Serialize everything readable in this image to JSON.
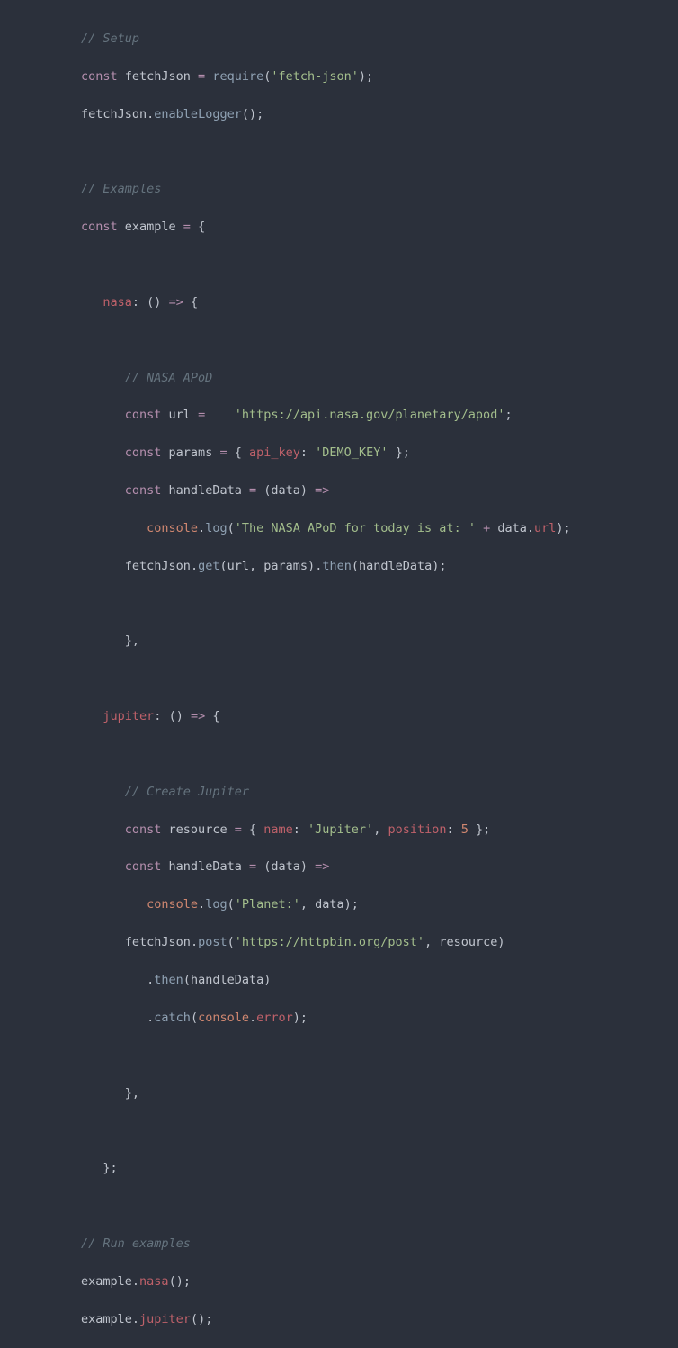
{
  "lines": {
    "l1_comment": "// Setup",
    "l2_const": "const",
    "l2_fetchJson": " fetchJson ",
    "l2_eq": "=",
    "l2_require": " require",
    "l2_p1": "(",
    "l2_str": "'fetch-json'",
    "l2_p2": ")",
    "l2_semi": ";",
    "l3_fetchJson": "fetchJson",
    "l3_dot": ".",
    "l3_enable": "enableLogger",
    "l3_p": "();",
    "l5_comment": "// Examples",
    "l6_const": "const",
    "l6_example": " example ",
    "l6_eq": "=",
    "l6_brace": " {",
    "l8_nasa": "nasa",
    "l8_colon": ":",
    "l8_parens": " () ",
    "l8_arrow": "=>",
    "l8_brace": " {",
    "l10_comment": "// NASA APoD",
    "l11_const": "const",
    "l11_url": " url ",
    "l11_eq": "=",
    "l11_sp": "    ",
    "l11_str": "'https://api.nasa.gov/planetary/apod'",
    "l11_semi": ";",
    "l12_const": "const",
    "l12_params": " params ",
    "l12_eq": "=",
    "l12_brace1": " { ",
    "l12_apikey": "api_key",
    "l12_colon": ":",
    "l12_sp": " ",
    "l12_str": "'DEMO_KEY'",
    "l12_brace2": " };",
    "l13_const": "const",
    "l13_handle": " handleData ",
    "l13_eq": "=",
    "l13_p1": " (",
    "l13_data": "data",
    "l13_p2": ") ",
    "l13_arrow": "=>",
    "l14_console": "console",
    "l14_dot": ".",
    "l14_log": "log",
    "l14_p1": "(",
    "l14_str": "'The NASA APoD for today is at: '",
    "l14_plus": " + ",
    "l14_data": "data",
    "l14_dot2": ".",
    "l14_url": "url",
    "l14_p2": ");",
    "l15_fetchJson": "fetchJson",
    "l15_dot": ".",
    "l15_get": "get",
    "l15_p1": "(",
    "l15_url": "url",
    "l15_comma": ", ",
    "l15_params": "params",
    "l15_p2": ")",
    "l15_dot2": ".",
    "l15_then": "then",
    "l15_p3": "(",
    "l15_handle": "handleData",
    "l15_p4": ");",
    "l17_close": "},",
    "l19_jupiter": "jupiter",
    "l19_colon": ":",
    "l19_parens": " () ",
    "l19_arrow": "=>",
    "l19_brace": " {",
    "l21_comment": "// Create Jupiter",
    "l22_const": "const",
    "l22_resource": " resource ",
    "l22_eq": "=",
    "l22_brace1": " { ",
    "l22_name": "name",
    "l22_colon1": ":",
    "l22_sp1": " ",
    "l22_str": "'Jupiter'",
    "l22_comma": ", ",
    "l22_position": "position",
    "l22_colon2": ":",
    "l22_sp2": " ",
    "l22_num": "5",
    "l22_brace2": " };",
    "l23_const": "const",
    "l23_handle": " handleData ",
    "l23_eq": "=",
    "l23_p1": " (",
    "l23_data": "data",
    "l23_p2": ") ",
    "l23_arrow": "=>",
    "l24_console": "console",
    "l24_dot": ".",
    "l24_log": "log",
    "l24_p1": "(",
    "l24_str": "'Planet:'",
    "l24_comma": ", ",
    "l24_data": "data",
    "l24_p2": ");",
    "l25_fetchJson": "fetchJson",
    "l25_dot": ".",
    "l25_post": "post",
    "l25_p1": "(",
    "l25_str": "'https://httpbin.org/post'",
    "l25_comma": ", ",
    "l25_resource": "resource",
    "l25_p2": ")",
    "l26_dot": ".",
    "l26_then": "then",
    "l26_p1": "(",
    "l26_handle": "handleData",
    "l26_p2": ")",
    "l27_dot": ".",
    "l27_catch": "catch",
    "l27_p1": "(",
    "l27_console": "console",
    "l27_dot2": ".",
    "l27_error": "error",
    "l27_p2": ");",
    "l29_close": "},",
    "l31_close": "};",
    "l33_comment": "// Run examples",
    "l34_example": "example",
    "l34_dot": ".",
    "l34_nasa": "nasa",
    "l34_p": "();",
    "l35_example": "example",
    "l35_dot": ".",
    "l35_jupiter": "jupiter",
    "l35_p": "();"
  }
}
